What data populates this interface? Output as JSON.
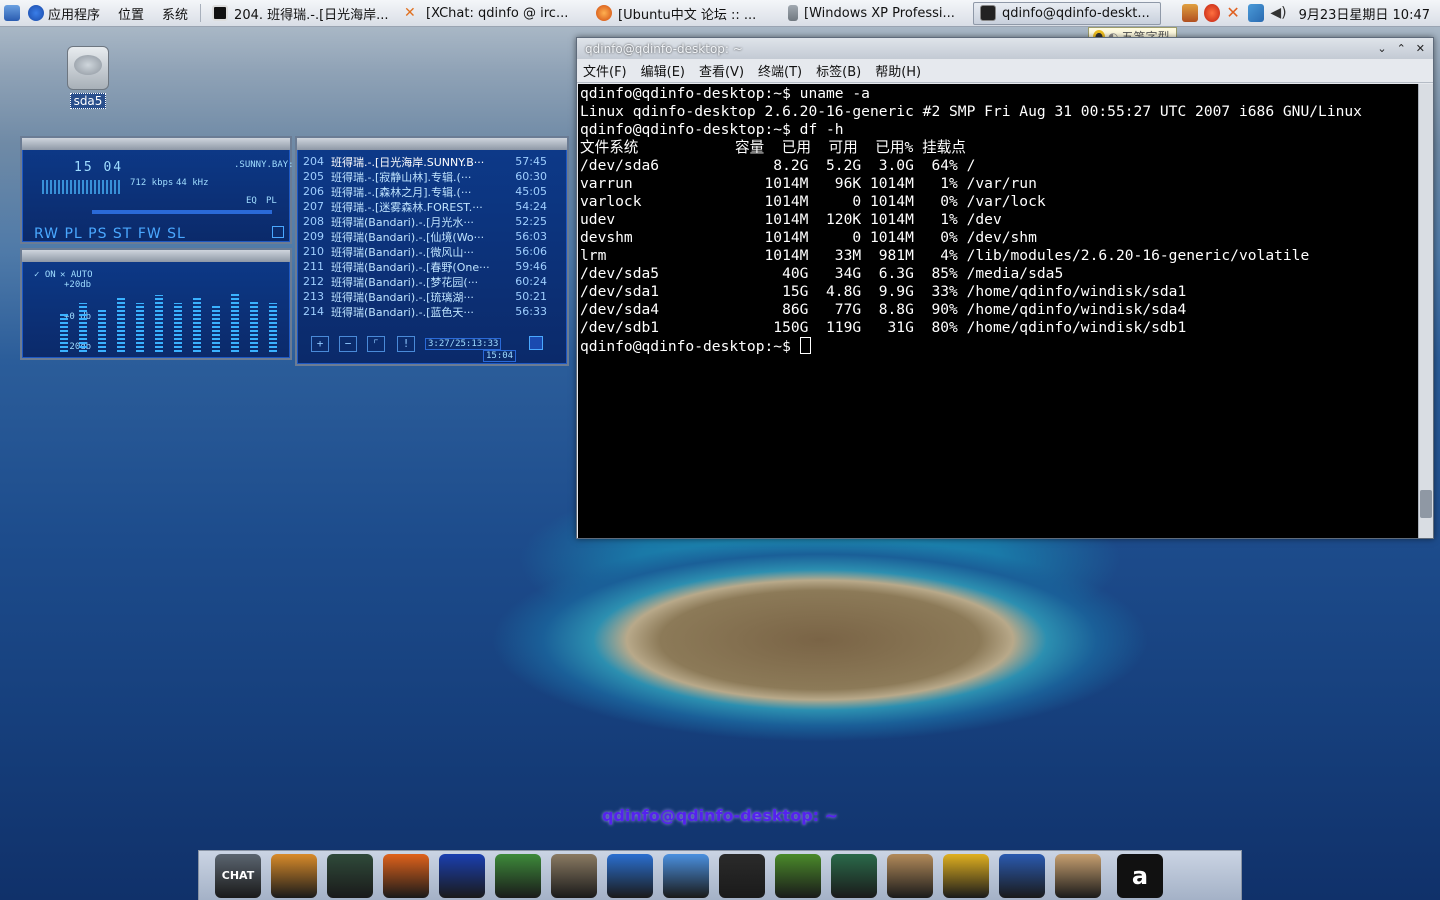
{
  "top_panel": {
    "menus": [
      "应用程序",
      "位置",
      "系统"
    ],
    "tasks": [
      {
        "label": "204. 班得瑞.-.[日光海岸...",
        "active": false
      },
      {
        "label": "[XChat: qdinfo @ irc...",
        "active": false
      },
      {
        "label": "[Ubuntu中文 论坛 :: ...",
        "active": false
      },
      {
        "label": "[Windows XP Professi...",
        "active": false
      },
      {
        "label": "qdinfo@qdinfo-deskt...",
        "active": true
      }
    ],
    "clock": "9月23日星期日 10:47"
  },
  "ime": {
    "label": "五笔字型"
  },
  "desktop_icon": {
    "label": "sda5"
  },
  "player_main": {
    "time": "15 04",
    "title_scroll": ".SUNNY.BAY:",
    "bitrate": "712 kbps",
    "samplerate": "44 kHz",
    "eq_label": "EQ",
    "pl_label": "PL",
    "buttons": "RW PL PS ST FW    SL"
  },
  "player_eq": {
    "on": "ON",
    "auto": "AUTO",
    "top": "+20db",
    "mid": "+0 db",
    "bot": "-20db",
    "levels": [
      0.55,
      0.7,
      0.62,
      0.78,
      0.7,
      0.82,
      0.7,
      0.78,
      0.66,
      0.85,
      0.74,
      0.7
    ]
  },
  "playlist": {
    "items": [
      {
        "n": "204",
        "title": "班得瑞.-.[日光海岸.SUNNY.B···",
        "dur": "57:45",
        "sel": true
      },
      {
        "n": "205",
        "title": "班得瑞.-.[寂静山林].专辑.(···",
        "dur": "60:30"
      },
      {
        "n": "206",
        "title": "班得瑞.-.[森林之月].专辑.(···",
        "dur": "45:05"
      },
      {
        "n": "207",
        "title": "班得瑞.-.[迷雾森林.FOREST.···",
        "dur": "54:24"
      },
      {
        "n": "208",
        "title": "班得瑞(Bandari).-.[月光水···",
        "dur": "52:25"
      },
      {
        "n": "209",
        "title": "班得瑞(Bandari).-.[仙境(Wo···",
        "dur": "56:03"
      },
      {
        "n": "210",
        "title": "班得瑞(Bandari).-.[微风山···",
        "dur": "56:06"
      },
      {
        "n": "211",
        "title": "班得瑞(Bandari).-.[春野(One···",
        "dur": "59:46"
      },
      {
        "n": "212",
        "title": "班得瑞(Bandari).-.[梦花园(···",
        "dur": "60:24"
      },
      {
        "n": "213",
        "title": "班得瑞(Bandari).-.[琉璃湖···",
        "dur": "50:21"
      },
      {
        "n": "214",
        "title": "班得瑞(Bandari).-.[蓝色天···",
        "dur": "56:33"
      }
    ],
    "total": "3:27/25:13:33",
    "current": "15:04"
  },
  "terminal": {
    "title": "qdinfo@qdinfo-desktop: ~",
    "menus": [
      "文件(F)",
      "编辑(E)",
      "查看(V)",
      "终端(T)",
      "标签(B)",
      "帮助(H)"
    ],
    "lines": [
      "qdinfo@qdinfo-desktop:~$ uname -a",
      "Linux qdinfo-desktop 2.6.20-16-generic #2 SMP Fri Aug 31 00:55:27 UTC 2007 i686 GNU/Linux",
      "qdinfo@qdinfo-desktop:~$ df -h",
      "文件系统           容量  已用  可用  已用% 挂载点",
      "/dev/sda6             8.2G  5.2G  3.0G  64% /",
      "varrun               1014M   96K 1014M   1% /var/run",
      "varlock              1014M     0 1014M   0% /var/lock",
      "udev                 1014M  120K 1014M   1% /dev",
      "devshm               1014M     0 1014M   0% /dev/shm",
      "lrm                  1014M   33M  981M   4% /lib/modules/2.6.20-16-generic/volatile",
      "/dev/sda5              40G   34G  6.3G  85% /media/sda5",
      "/dev/sda1              15G  4.8G  9.9G  33% /home/qdinfo/windisk/sda1",
      "/dev/sda4              86G   77G  8.8G  90% /home/qdinfo/windisk/sda4",
      "/dev/sdb1             150G  119G   31G  80% /home/qdinfo/windisk/sdb1"
    ],
    "prompt": "qdinfo@qdinfo-desktop:~$ "
  },
  "dock": {
    "title": "qdinfo@qdinfo-desktop: ~",
    "xchat_label": "CHAT",
    "last_label": "a",
    "items": [
      {
        "name": "xchat-icon",
        "color": "#5b6570"
      },
      {
        "name": "movie-player-icon",
        "color": "#d98b2a"
      },
      {
        "name": "network-globe-icon",
        "color": "#2f4a3a"
      },
      {
        "name": "firefox-icon",
        "color": "#e0621b"
      },
      {
        "name": "blue-bird-icon",
        "color": "#1a3fb0"
      },
      {
        "name": "file-manager-icon",
        "color": "#3d8a3a"
      },
      {
        "name": "gimp-icon",
        "color": "#8a7a62"
      },
      {
        "name": "writer-icon",
        "color": "#2a6fd0"
      },
      {
        "name": "messenger-icon",
        "color": "#4a90e0"
      },
      {
        "name": "terminal-icon",
        "color": "#2b2b2b"
      },
      {
        "name": "book-icon",
        "color": "#4a8a2a"
      },
      {
        "name": "system-monitor-icon",
        "color": "#2a6a4a"
      },
      {
        "name": "rabbit-icon",
        "color": "#b28a5a"
      },
      {
        "name": "resize-icon",
        "color": "#e0b020"
      },
      {
        "name": "media-play-icon",
        "color": "#2a5ab0"
      },
      {
        "name": "home-icon",
        "color": "#c8a070"
      }
    ]
  }
}
